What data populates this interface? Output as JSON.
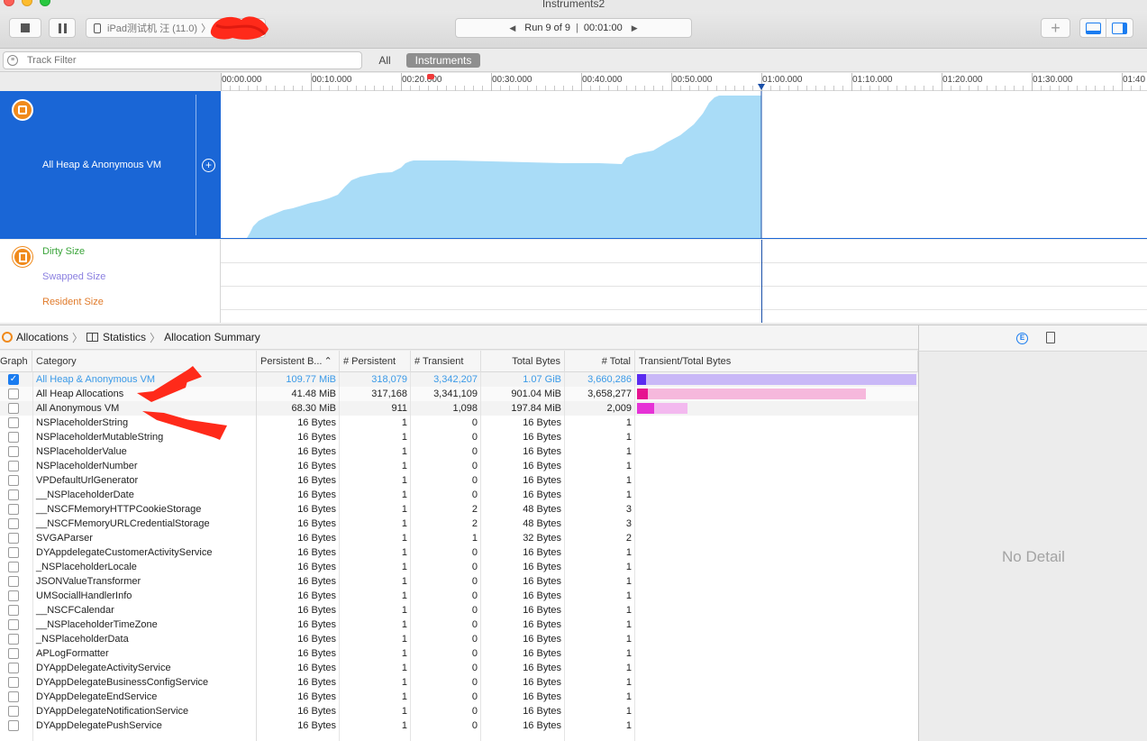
{
  "window": {
    "title": "Instruments2"
  },
  "toolbar": {
    "device_label": "iPad测试机 汪 (11.0)",
    "run_label": "Run 9 of 9",
    "time_label": "00:01:00"
  },
  "filter": {
    "placeholder": "Track Filter",
    "scope_all": "All",
    "scope_instruments": "Instruments"
  },
  "ruler": {
    "ticks": [
      "00:00.000",
      "00:10.000",
      "00:20.000",
      "00:30.000",
      "00:40.000",
      "00:50.000",
      "01:00.000",
      "01:10.000",
      "01:20.000",
      "01:30.000",
      "01:40"
    ]
  },
  "track": {
    "name": "All Heap & Anonymous VM",
    "sub_tracks": [
      {
        "label": "Dirty Size",
        "color": "#3aa43a"
      },
      {
        "label": "Swapped Size",
        "color": "#8a7fe0"
      },
      {
        "label": "Resident Size",
        "color": "#e07a2a"
      }
    ]
  },
  "jumpbar": {
    "instrument": "Allocations",
    "view": "Statistics",
    "section": "Allocation Summary"
  },
  "table": {
    "headers": {
      "graph": "Graph",
      "category": "Category",
      "persistent_bytes": "Persistent B...",
      "persistent": "# Persistent",
      "transient": "# Transient",
      "total_bytes": "Total Bytes",
      "total": "# Total",
      "bar": "Transient/Total Bytes"
    },
    "rows": [
      {
        "checked": true,
        "category": "All Heap & Anonymous VM",
        "persistent_bytes": "109.77 MiB",
        "persistent": "318,079",
        "transient": "3,342,207",
        "total_bytes": "1.07 GiB",
        "total": "3,660,286",
        "bar_persist": 0.03,
        "bar_total": 1.0,
        "dark": "#5b2bf0",
        "light": "#c9b8f7"
      },
      {
        "checked": false,
        "category": "All Heap Allocations",
        "persistent_bytes": "41.48 MiB",
        "persistent": "317,168",
        "transient": "3,341,109",
        "total_bytes": "901.04 MiB",
        "total": "3,658,277",
        "bar_persist": 0.04,
        "bar_total": 0.82,
        "dark": "#e6138f",
        "light": "#f6b8dc"
      },
      {
        "checked": false,
        "category": "All Anonymous VM",
        "persistent_bytes": "68.30 MiB",
        "persistent": "911",
        "transient": "1,098",
        "total_bytes": "197.84 MiB",
        "total": "2,009",
        "bar_persist": 0.06,
        "bar_total": 0.18,
        "dark": "#e632d6",
        "light": "#f3b9ef"
      },
      {
        "checked": false,
        "category": "NSPlaceholderString",
        "persistent_bytes": "16 Bytes",
        "persistent": "1",
        "transient": "0",
        "total_bytes": "16 Bytes",
        "total": "1"
      },
      {
        "checked": false,
        "category": "NSPlaceholderMutableString",
        "persistent_bytes": "16 Bytes",
        "persistent": "1",
        "transient": "0",
        "total_bytes": "16 Bytes",
        "total": "1"
      },
      {
        "checked": false,
        "category": "NSPlaceholderValue",
        "persistent_bytes": "16 Bytes",
        "persistent": "1",
        "transient": "0",
        "total_bytes": "16 Bytes",
        "total": "1"
      },
      {
        "checked": false,
        "category": "NSPlaceholderNumber",
        "persistent_bytes": "16 Bytes",
        "persistent": "1",
        "transient": "0",
        "total_bytes": "16 Bytes",
        "total": "1"
      },
      {
        "checked": false,
        "category": "VPDefaultUrlGenerator",
        "persistent_bytes": "16 Bytes",
        "persistent": "1",
        "transient": "0",
        "total_bytes": "16 Bytes",
        "total": "1"
      },
      {
        "checked": false,
        "category": "__NSPlaceholderDate",
        "persistent_bytes": "16 Bytes",
        "persistent": "1",
        "transient": "0",
        "total_bytes": "16 Bytes",
        "total": "1"
      },
      {
        "checked": false,
        "category": "__NSCFMemoryHTTPCookieStorage",
        "persistent_bytes": "16 Bytes",
        "persistent": "1",
        "transient": "2",
        "total_bytes": "48 Bytes",
        "total": "3"
      },
      {
        "checked": false,
        "category": "__NSCFMemoryURLCredentialStorage",
        "persistent_bytes": "16 Bytes",
        "persistent": "1",
        "transient": "2",
        "total_bytes": "48 Bytes",
        "total": "3"
      },
      {
        "checked": false,
        "category": "SVGAParser",
        "persistent_bytes": "16 Bytes",
        "persistent": "1",
        "transient": "1",
        "total_bytes": "32 Bytes",
        "total": "2"
      },
      {
        "checked": false,
        "category": "DYAppdelegateCustomerActivityService",
        "persistent_bytes": "16 Bytes",
        "persistent": "1",
        "transient": "0",
        "total_bytes": "16 Bytes",
        "total": "1"
      },
      {
        "checked": false,
        "category": "_NSPlaceholderLocale",
        "persistent_bytes": "16 Bytes",
        "persistent": "1",
        "transient": "0",
        "total_bytes": "16 Bytes",
        "total": "1"
      },
      {
        "checked": false,
        "category": "JSONValueTransformer",
        "persistent_bytes": "16 Bytes",
        "persistent": "1",
        "transient": "0",
        "total_bytes": "16 Bytes",
        "total": "1"
      },
      {
        "checked": false,
        "category": "UMSociallHandlerInfo",
        "persistent_bytes": "16 Bytes",
        "persistent": "1",
        "transient": "0",
        "total_bytes": "16 Bytes",
        "total": "1"
      },
      {
        "checked": false,
        "category": "__NSCFCalendar",
        "persistent_bytes": "16 Bytes",
        "persistent": "1",
        "transient": "0",
        "total_bytes": "16 Bytes",
        "total": "1"
      },
      {
        "checked": false,
        "category": "__NSPlaceholderTimeZone",
        "persistent_bytes": "16 Bytes",
        "persistent": "1",
        "transient": "0",
        "total_bytes": "16 Bytes",
        "total": "1"
      },
      {
        "checked": false,
        "category": "_NSPlaceholderData",
        "persistent_bytes": "16 Bytes",
        "persistent": "1",
        "transient": "0",
        "total_bytes": "16 Bytes",
        "total": "1"
      },
      {
        "checked": false,
        "category": "APLogFormatter",
        "persistent_bytes": "16 Bytes",
        "persistent": "1",
        "transient": "0",
        "total_bytes": "16 Bytes",
        "total": "1"
      },
      {
        "checked": false,
        "category": "DYAppDelegateActivityService",
        "persistent_bytes": "16 Bytes",
        "persistent": "1",
        "transient": "0",
        "total_bytes": "16 Bytes",
        "total": "1"
      },
      {
        "checked": false,
        "category": "DYAppDelegateBusinessConfigService",
        "persistent_bytes": "16 Bytes",
        "persistent": "1",
        "transient": "0",
        "total_bytes": "16 Bytes",
        "total": "1"
      },
      {
        "checked": false,
        "category": "DYAppDelegateEndService",
        "persistent_bytes": "16 Bytes",
        "persistent": "1",
        "transient": "0",
        "total_bytes": "16 Bytes",
        "total": "1"
      },
      {
        "checked": false,
        "category": "DYAppDelegateNotificationService",
        "persistent_bytes": "16 Bytes",
        "persistent": "1",
        "transient": "0",
        "total_bytes": "16 Bytes",
        "total": "1"
      },
      {
        "checked": false,
        "category": "DYAppDelegatePushService",
        "persistent_bytes": "16 Bytes",
        "persistent": "1",
        "transient": "0",
        "total_bytes": "16 Bytes",
        "total": "1"
      }
    ]
  },
  "inspector": {
    "empty_text": "No Detail"
  },
  "colors": {
    "accent": "#1a66d6",
    "graph_fill": "#a9dcf7",
    "selected_text": "#3b9ae8",
    "arrow": "#ff2a1a"
  }
}
